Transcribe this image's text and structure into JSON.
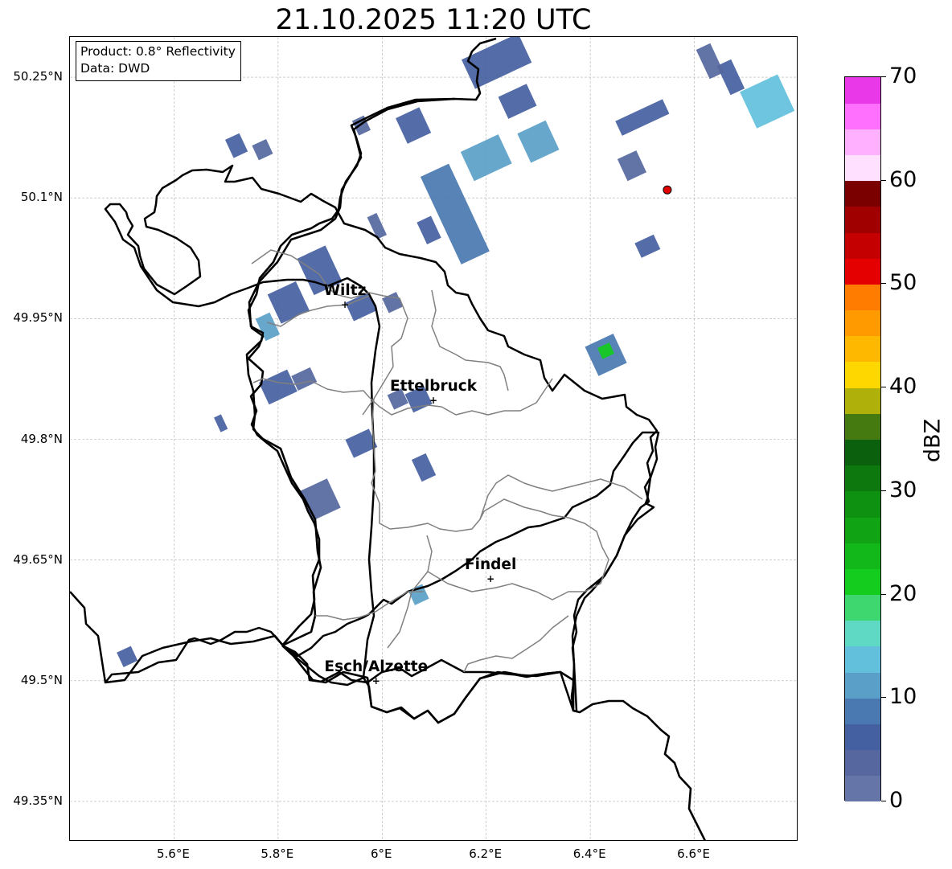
{
  "title": "21.10.2025 11:20 UTC",
  "info_box": {
    "product": "Product: 0.8° Reflectivity",
    "data": "Data: DWD"
  },
  "map": {
    "lon_range": [
      5.4,
      6.8
    ],
    "lat_range": [
      49.3,
      50.3
    ],
    "grid": true,
    "lat_ticks": [
      {
        "value": 50.25,
        "label": "50.25°N"
      },
      {
        "value": 50.1,
        "label": "50.1°N"
      },
      {
        "value": 49.95,
        "label": "49.95°N"
      },
      {
        "value": 49.8,
        "label": "49.8°N"
      },
      {
        "value": 49.65,
        "label": "49.65°N"
      },
      {
        "value": 49.5,
        "label": "49.5°N"
      },
      {
        "value": 49.35,
        "label": "49.35°N"
      }
    ],
    "lon_ticks": [
      {
        "value": 5.6,
        "label": "5.6°E"
      },
      {
        "value": 5.8,
        "label": "5.8°E"
      },
      {
        "value": 6.0,
        "label": "6°E"
      },
      {
        "value": 6.2,
        "label": "6.2°E"
      },
      {
        "value": 6.4,
        "label": "6.4°E"
      },
      {
        "value": 6.6,
        "label": "6.6°E"
      }
    ],
    "cities": [
      {
        "name": "Wiltz",
        "lon": 5.93,
        "lat": 49.966
      },
      {
        "name": "Ettelbruck",
        "lon": 6.1,
        "lat": 49.847
      },
      {
        "name": "Findel",
        "lon": 6.21,
        "lat": 49.626
      },
      {
        "name": "Esch/Alzette",
        "lon": 5.99,
        "lat": 49.499
      }
    ],
    "radar_site": {
      "lon": 6.548,
      "lat": 50.11,
      "color": "#e00000"
    }
  },
  "colorbar": {
    "label": "dBZ",
    "min": 0,
    "max": 70,
    "ticks": [
      {
        "value": 0,
        "label": "0"
      },
      {
        "value": 10,
        "label": "10"
      },
      {
        "value": 20,
        "label": "20"
      },
      {
        "value": 30,
        "label": "30"
      },
      {
        "value": 40,
        "label": "40"
      },
      {
        "value": 50,
        "label": "50"
      },
      {
        "value": 60,
        "label": "60"
      },
      {
        "value": 70,
        "label": "70"
      }
    ],
    "colors": [
      "#6675a8",
      "#55679e",
      "#4560a0",
      "#4a78b0",
      "#5a9fc8",
      "#62c0dc",
      "#5fd8c4",
      "#3ed66e",
      "#14cc1e",
      "#12b81a",
      "#10a414",
      "#0e9010",
      "#0c780e",
      "#0a600c",
      "#447a10",
      "#b0b00a",
      "#ffd700",
      "#ffb800",
      "#ff9a00",
      "#ff7c00",
      "#e40000",
      "#c40000",
      "#a00000",
      "#7a0000",
      "#ffe0ff",
      "#ffb0ff",
      "#ff70ff",
      "#e838e8"
    ]
  },
  "reflectivity_cells": [
    {
      "lon": 5.72,
      "lat": 50.165,
      "w": 0.03,
      "h": 0.025,
      "dbz": 5
    },
    {
      "lon": 5.77,
      "lat": 50.16,
      "w": 0.03,
      "h": 0.02,
      "dbz": 4
    },
    {
      "lon": 5.96,
      "lat": 50.19,
      "w": 0.025,
      "h": 0.02,
      "dbz": 3
    },
    {
      "lon": 6.06,
      "lat": 50.19,
      "w": 0.05,
      "h": 0.035,
      "dbz": 6
    },
    {
      "lon": 6.14,
      "lat": 50.08,
      "w": 0.06,
      "h": 0.12,
      "dbz": 8
    },
    {
      "lon": 6.2,
      "lat": 50.15,
      "w": 0.08,
      "h": 0.04,
      "dbz": 10
    },
    {
      "lon": 6.3,
      "lat": 50.17,
      "w": 0.06,
      "h": 0.04,
      "dbz": 12
    },
    {
      "lon": 6.22,
      "lat": 50.27,
      "w": 0.12,
      "h": 0.04,
      "dbz": 6
    },
    {
      "lon": 6.26,
      "lat": 50.22,
      "w": 0.06,
      "h": 0.03,
      "dbz": 5
    },
    {
      "lon": 6.5,
      "lat": 50.2,
      "w": 0.1,
      "h": 0.02,
      "dbz": 5
    },
    {
      "lon": 6.48,
      "lat": 50.14,
      "w": 0.04,
      "h": 0.03,
      "dbz": 4
    },
    {
      "lon": 6.74,
      "lat": 50.22,
      "w": 0.08,
      "h": 0.05,
      "dbz": 14
    },
    {
      "lon": 6.67,
      "lat": 50.25,
      "w": 0.03,
      "h": 0.04,
      "dbz": 5
    },
    {
      "lon": 6.51,
      "lat": 50.04,
      "w": 0.04,
      "h": 0.02,
      "dbz": 6
    },
    {
      "lon": 6.09,
      "lat": 50.06,
      "w": 0.03,
      "h": 0.03,
      "dbz": 5
    },
    {
      "lon": 5.99,
      "lat": 50.065,
      "w": 0.02,
      "h": 0.03,
      "dbz": 4
    },
    {
      "lon": 5.88,
      "lat": 50.01,
      "w": 0.06,
      "h": 0.05,
      "dbz": 5
    },
    {
      "lon": 5.82,
      "lat": 49.97,
      "w": 0.06,
      "h": 0.04,
      "dbz": 6
    },
    {
      "lon": 5.78,
      "lat": 49.94,
      "w": 0.03,
      "h": 0.03,
      "dbz": 10
    },
    {
      "lon": 5.96,
      "lat": 49.965,
      "w": 0.05,
      "h": 0.025,
      "dbz": 5
    },
    {
      "lon": 6.02,
      "lat": 49.97,
      "w": 0.03,
      "h": 0.02,
      "dbz": 4
    },
    {
      "lon": 5.8,
      "lat": 49.865,
      "w": 0.06,
      "h": 0.03,
      "dbz": 5
    },
    {
      "lon": 5.85,
      "lat": 49.875,
      "w": 0.04,
      "h": 0.02,
      "dbz": 4
    },
    {
      "lon": 5.69,
      "lat": 49.82,
      "w": 0.015,
      "h": 0.02,
      "dbz": 5
    },
    {
      "lon": 6.07,
      "lat": 49.85,
      "w": 0.04,
      "h": 0.025,
      "dbz": 5
    },
    {
      "lon": 6.03,
      "lat": 49.85,
      "w": 0.03,
      "h": 0.02,
      "dbz": 4
    },
    {
      "lon": 5.96,
      "lat": 49.795,
      "w": 0.05,
      "h": 0.025,
      "dbz": 5
    },
    {
      "lon": 6.08,
      "lat": 49.765,
      "w": 0.03,
      "h": 0.03,
      "dbz": 6
    },
    {
      "lon": 5.88,
      "lat": 49.725,
      "w": 0.06,
      "h": 0.04,
      "dbz": 4
    },
    {
      "lon": 6.43,
      "lat": 49.905,
      "w": 0.06,
      "h": 0.04,
      "dbz": 8
    },
    {
      "lon": 6.43,
      "lat": 49.91,
      "w": 0.025,
      "h": 0.015,
      "dbz": 22
    },
    {
      "lon": 6.07,
      "lat": 49.607,
      "w": 0.03,
      "h": 0.02,
      "dbz": 12
    },
    {
      "lon": 5.51,
      "lat": 49.53,
      "w": 0.03,
      "h": 0.02,
      "dbz": 5
    },
    {
      "lon": 6.63,
      "lat": 50.27,
      "w": 0.03,
      "h": 0.04,
      "dbz": 4
    }
  ]
}
